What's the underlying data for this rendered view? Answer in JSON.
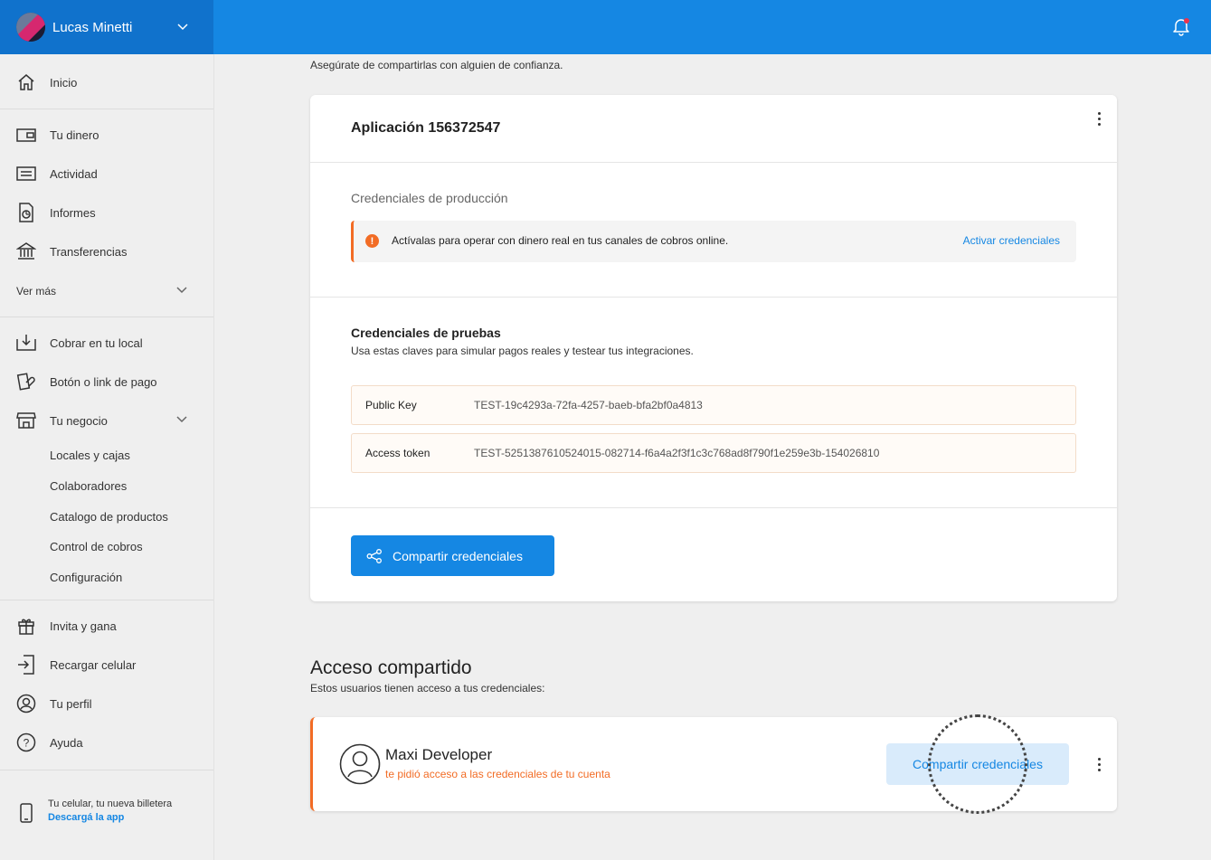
{
  "header": {
    "user_name": "Lucas Minetti",
    "icons": {
      "dropdown": "chevron-down-icon",
      "notifications": "bell-icon"
    },
    "accent_color": "#1587e3"
  },
  "sidebar": {
    "items": [
      {
        "label": "Inicio",
        "icon": "home-icon"
      },
      {
        "label": "Tu dinero",
        "icon": "wallet-icon"
      },
      {
        "label": "Actividad",
        "icon": "list-icon"
      },
      {
        "label": "Informes",
        "icon": "report-icon"
      },
      {
        "label": "Transferencias",
        "icon": "bank-icon"
      },
      {
        "label": "Ver más",
        "icon": "chevron-down-icon"
      },
      {
        "label": "Cobrar en tu local",
        "icon": "download-box-icon"
      },
      {
        "label": "Botón o link de pago",
        "icon": "payment-link-icon"
      },
      {
        "label": "Tu negocio",
        "icon": "store-icon"
      },
      {
        "label": "Invita y gana",
        "icon": "gift-icon"
      },
      {
        "label": "Recargar celular",
        "icon": "phone-recharge-icon"
      },
      {
        "label": "Tu perfil",
        "icon": "profile-icon"
      },
      {
        "label": "Ayuda",
        "icon": "help-icon"
      }
    ],
    "business_sub": [
      "Locales y cajas",
      "Colaboradores",
      "Catalogo de productos",
      "Control de cobros",
      "Configuración"
    ],
    "promo": {
      "line1": "Tu celular, tu nueva billetera",
      "line2": "Descargá la app"
    }
  },
  "main": {
    "top_note": "Asegúrate de compartirlas con alguien de confianza.",
    "app_title": "Aplicación 156372547",
    "production": {
      "label": "Credenciales de producción",
      "alert_text": "Actívalas para operar con dinero real en tus canales de cobros online.",
      "alert_link": "Activar credenciales"
    },
    "testing": {
      "title": "Credenciales de pruebas",
      "subtitle": "Usa estas claves para simular pagos reales y testear tus integraciones.",
      "rows": [
        {
          "key": "Public Key",
          "value": "TEST-19c4293a-72fa-4257-baeb-bfa2bf0a4813"
        },
        {
          "key": "Access token",
          "value": "TEST-5251387610524015-082714-f6a4a2f3f1c3c768ad8f790f1e259e3b-154026810"
        }
      ]
    },
    "share_button": "Compartir credenciales",
    "shared_access": {
      "title": "Acceso compartido",
      "subtitle": "Estos usuarios tienen acceso a tus credenciales:",
      "user": {
        "name": "Maxi Developer",
        "description": "te pidió acceso a las credenciales de tu cuenta",
        "button": "Compartir credenciales"
      }
    }
  }
}
